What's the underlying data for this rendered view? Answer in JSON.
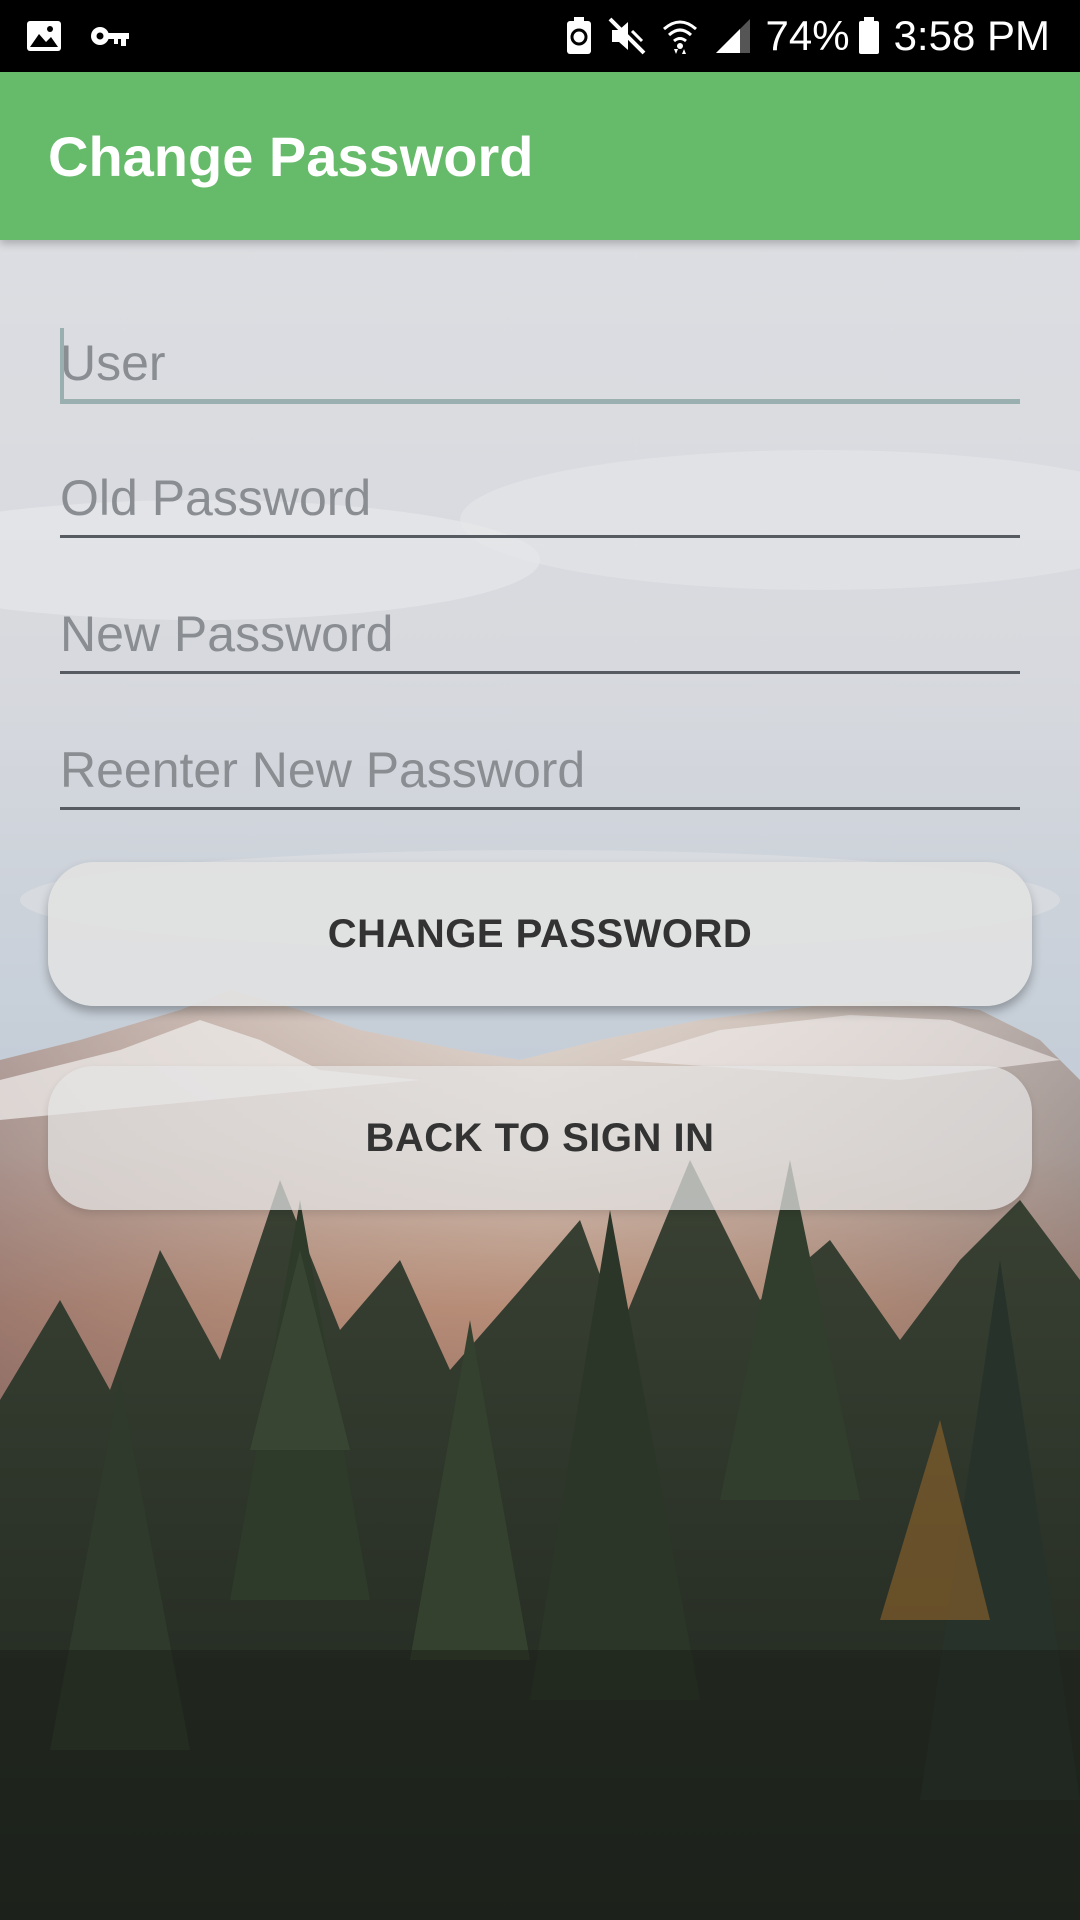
{
  "status_bar": {
    "left_icons": [
      "image-icon",
      "key-icon"
    ],
    "right_icons": [
      "battery-saver-icon",
      "mute-icon",
      "wifi-icon",
      "signal-icon",
      "battery-icon"
    ],
    "battery_percent": "74%",
    "time": "3:58 PM"
  },
  "app_bar": {
    "title": "Change Password",
    "color": "#66bb6a"
  },
  "form": {
    "user": {
      "placeholder": "User",
      "value": ""
    },
    "old_password": {
      "placeholder": "Old Password",
      "value": ""
    },
    "new_password": {
      "placeholder": "New Password",
      "value": ""
    },
    "reenter_password": {
      "placeholder": "Reenter New Password",
      "value": ""
    }
  },
  "buttons": {
    "change_password": "CHANGE PASSWORD",
    "back_to_sign_in": "BACK TO SIGN IN"
  },
  "background": {
    "description_icon": "mountain-forest-background"
  }
}
